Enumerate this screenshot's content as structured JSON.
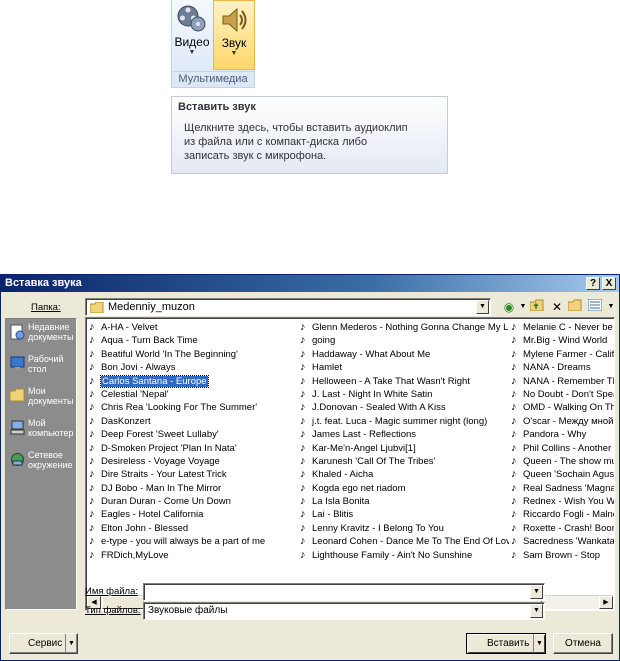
{
  "ribbon": {
    "video_label": "Видео",
    "sound_label": "Звук",
    "group_label": "Мультимедиа"
  },
  "tooltip": {
    "title": "Вставить звук",
    "lines": [
      "Щелкните здесь, чтобы вставить аудиоклип",
      "из файла или с компакт-диска либо",
      "записать звук с микрофона."
    ]
  },
  "dialog": {
    "title": "Вставка звука",
    "help_btn": "?",
    "close_btn": "X",
    "look_in_label": "Папка:",
    "look_in_value": "Medenniy_muzon",
    "places": [
      {
        "label": "Недавние документы",
        "icon": "recent-docs-icon"
      },
      {
        "label": "Рабочий стол",
        "icon": "desktop-icon"
      },
      {
        "label": "Мои документы",
        "icon": "my-documents-icon"
      },
      {
        "label": "Мой компьютер",
        "icon": "my-computer-icon"
      },
      {
        "label": "Сетевое окружение",
        "icon": "network-icon"
      }
    ],
    "files_col1": [
      "A-HA - Velvet",
      "Aqua - Turn Back Time",
      "Beatiful World 'In The Beginning'",
      "Bon Jovi - Always",
      "Carlos Santana - Europe",
      "Celestial 'Nepal'",
      "Chris Rea 'Looking For The Summer'",
      "DasKonzert",
      "Deep Forest 'Sweet Lullaby'",
      "D-Smoken Project 'Plan In Nata'",
      "Desireless - Voyage Voyage",
      "Dire Straits - Your Latest Trick",
      "DJ Bobo - Man In The Mirror",
      "Duran Duran - Come Un Down",
      "Eagles - Hotel California",
      "Elton John - Blessed",
      "e-type - you will always be a part of me",
      "FRDich,MyLove"
    ],
    "files_col2": [
      "Glenn Mederos - Nothing Gonna Change My Love",
      "going",
      "Haddaway - What About Me",
      "Hamlet",
      "Helloween - A Take That Wasn't Right",
      "J. Last - Night In White Satin",
      "J.Donovan - Sealed With A Kiss",
      "j.t. feat. Luca - Magic summer night (long)",
      "James Last - Reflections",
      "Kar-Me'n-Angel Ljubvi[1]",
      "Karunesh 'Call Of The Tribes'",
      "Khaled - Aicha",
      "Kogda ego net riadom",
      "La Isla Bonita",
      "Lai - Blitis",
      "Lenny Kravitz - I Belong To You",
      "Leonard Cohen - Dance Me To The End Of Love",
      "Lighthouse Family - Ain't No Sunshine"
    ],
    "files_col3": [
      "Melanie C - Never be t",
      "Mr.Big - Wind World",
      "Mylene Farmer - Califor",
      "NANA - Dreams",
      "NANA - Remember The",
      "No Doubt - Don't Speak",
      "OMD - Walking On The",
      "O'scar - Между мной и",
      "Pandora - Why",
      "Phil Collins - Another Da",
      "Queen - The show mus",
      "Queen 'Sochain Agus L",
      "Real Sadness 'Magna C",
      "Rednex - Wish You We",
      "Riccardo Fogli - Malnco",
      "Roxette - Crash! Boom",
      "Sacredness 'Wankatak",
      "Sam Brown - Stop"
    ],
    "selected_file": "Carlos Santana - Europe",
    "file_name_label": "Имя файла:",
    "file_name_value": "",
    "file_type_label": "Тип файлов:",
    "file_type_value": "Звуковые файлы",
    "service_btn": "Сервис",
    "insert_btn": "Вставить",
    "cancel_btn": "Отмена"
  }
}
